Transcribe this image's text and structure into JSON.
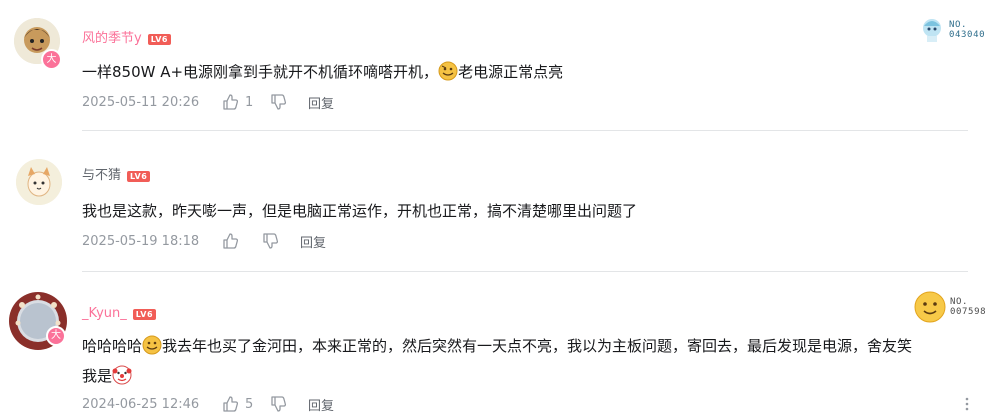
{
  "comments": [
    {
      "username": "风的季节y",
      "username_color": "#fb7299",
      "level": "LV6",
      "content_parts": [
        "一样850W A+电源刚拿到手就开不机循环嘀嗒开机，",
        "老电源正常点亮"
      ],
      "date": "2025-05-11 20:26",
      "likes": "1",
      "reply_label": "回复",
      "fan_badge": {
        "line1": "NO.",
        "line2": "043040"
      },
      "avatar_badge": "大"
    },
    {
      "username": "与不猜",
      "username_color": "#61666d",
      "level": "LV6",
      "content": "我也是这款，昨天嘭一声，但是电脑正常运作，开机也正常，搞不清楚哪里出问题了",
      "date": "2025-05-19 18:18",
      "likes": "",
      "reply_label": "回复"
    },
    {
      "username": "_Kyun_",
      "username_color": "#fb7299",
      "level": "LV6",
      "content_parts": [
        "哈哈哈哈",
        "我去年也买了金河田，本来正常的，然后突然有一天点不亮，我以为主板问题，寄回去，最后发现是电源，舍友笑",
        "我是"
      ],
      "date": "2024-06-25 12:46",
      "likes": "5",
      "reply_label": "回复",
      "fan_badge": {
        "line1": "NO.",
        "line2": "007598"
      },
      "avatar_badge": "大"
    }
  ]
}
